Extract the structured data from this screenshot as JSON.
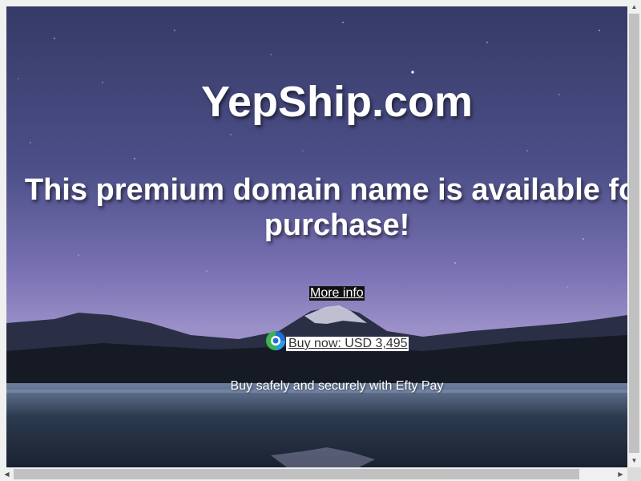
{
  "site": {
    "domain": "YepShip.com",
    "headline": "This premium domain name is available for purchase!",
    "more_info_label": "More info",
    "buy_now_label": " Buy now: USD 3,495",
    "tagline": "Buy safely and securely with Efty Pay"
  },
  "icons": {
    "payment_logo": "efty-pay-logo-icon",
    "scroll_up": "scroll-up-arrow-icon",
    "scroll_down": "scroll-down-arrow-icon",
    "scroll_left": "scroll-left-arrow-icon",
    "scroll_right": "scroll-right-arrow-icon"
  },
  "colors": {
    "text": "#ffffff",
    "more_info_bg": "#111111",
    "buy_now_bg": "#ffffff",
    "logo_blue": "#1e6fd9",
    "logo_green": "#3bb54a"
  }
}
